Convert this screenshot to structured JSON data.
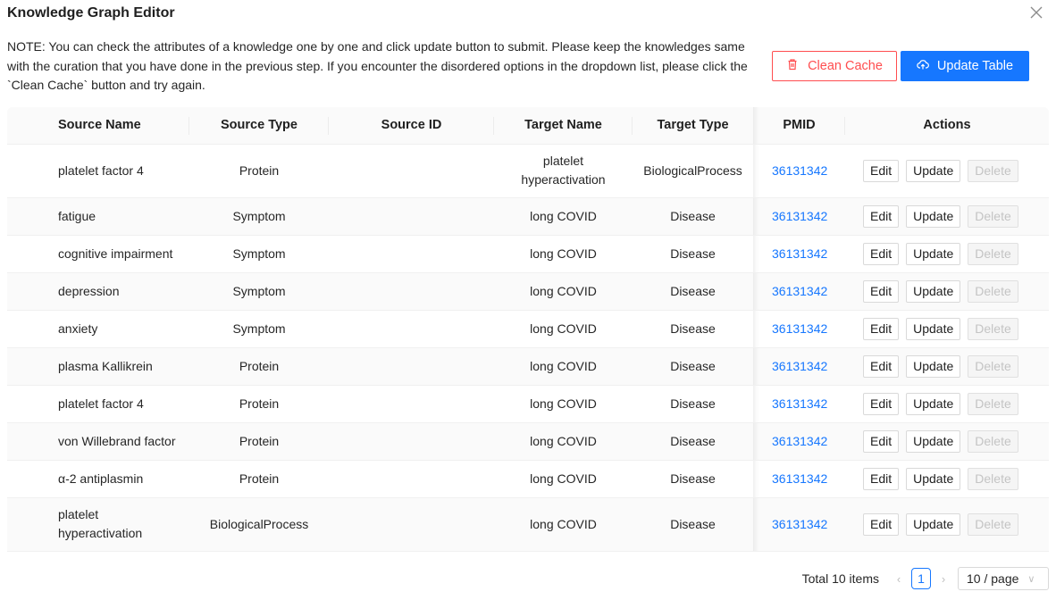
{
  "dialog": {
    "title": "Knowledge Graph Editor",
    "note": "NOTE: You can check the attributes of a knowledge one by one and click update button to submit. Please keep the knowledges same with the curation that you have done in the previous step. If you encounter the disordered options in the dropdown list, please click the `Clean Cache` button and try again."
  },
  "toolbar": {
    "clean_cache_label": "Clean Cache",
    "update_table_label": "Update Table",
    "clean_icon": "trash-icon",
    "update_icon": "cloud-upload-icon",
    "accent_color": "#1677ff",
    "danger_color": "#ff4d4f"
  },
  "table": {
    "columns": [
      "Source Name",
      "Source Type",
      "Source ID",
      "Target Name",
      "Target Type",
      "PMID",
      "Actions"
    ],
    "action_labels": {
      "edit": "Edit",
      "update": "Update",
      "delete": "Delete"
    },
    "rows": [
      {
        "source_name": "platelet factor 4",
        "source_type": "Protein",
        "source_id": "",
        "target_name": "platelet hyperactivation",
        "target_type": "BiologicalProcess",
        "pmid": "36131342"
      },
      {
        "source_name": "fatigue",
        "source_type": "Symptom",
        "source_id": "",
        "target_name": "long COVID",
        "target_type": "Disease",
        "pmid": "36131342"
      },
      {
        "source_name": "cognitive impairment",
        "source_type": "Symptom",
        "source_id": "",
        "target_name": "long COVID",
        "target_type": "Disease",
        "pmid": "36131342"
      },
      {
        "source_name": "depression",
        "source_type": "Symptom",
        "source_id": "",
        "target_name": "long COVID",
        "target_type": "Disease",
        "pmid": "36131342"
      },
      {
        "source_name": "anxiety",
        "source_type": "Symptom",
        "source_id": "",
        "target_name": "long COVID",
        "target_type": "Disease",
        "pmid": "36131342"
      },
      {
        "source_name": "plasma Kallikrein",
        "source_type": "Protein",
        "source_id": "",
        "target_name": "long COVID",
        "target_type": "Disease",
        "pmid": "36131342"
      },
      {
        "source_name": "platelet factor 4",
        "source_type": "Protein",
        "source_id": "",
        "target_name": "long COVID",
        "target_type": "Disease",
        "pmid": "36131342"
      },
      {
        "source_name": "von Willebrand factor",
        "source_type": "Protein",
        "source_id": "",
        "target_name": "long COVID",
        "target_type": "Disease",
        "pmid": "36131342"
      },
      {
        "source_name": "α-2 antiplasmin",
        "source_type": "Protein",
        "source_id": "",
        "target_name": "long COVID",
        "target_type": "Disease",
        "pmid": "36131342"
      },
      {
        "source_name": "platelet hyperactivation",
        "source_type": "BiologicalProcess",
        "source_id": "",
        "target_name": "long COVID",
        "target_type": "Disease",
        "pmid": "36131342"
      }
    ]
  },
  "pagination": {
    "total_label": "Total 10 items",
    "current_page": "1",
    "page_size_label": "10 / page",
    "prev_icon": "chevron-left-icon",
    "next_icon": "chevron-right-icon",
    "size_icon": "chevron-down-icon"
  }
}
